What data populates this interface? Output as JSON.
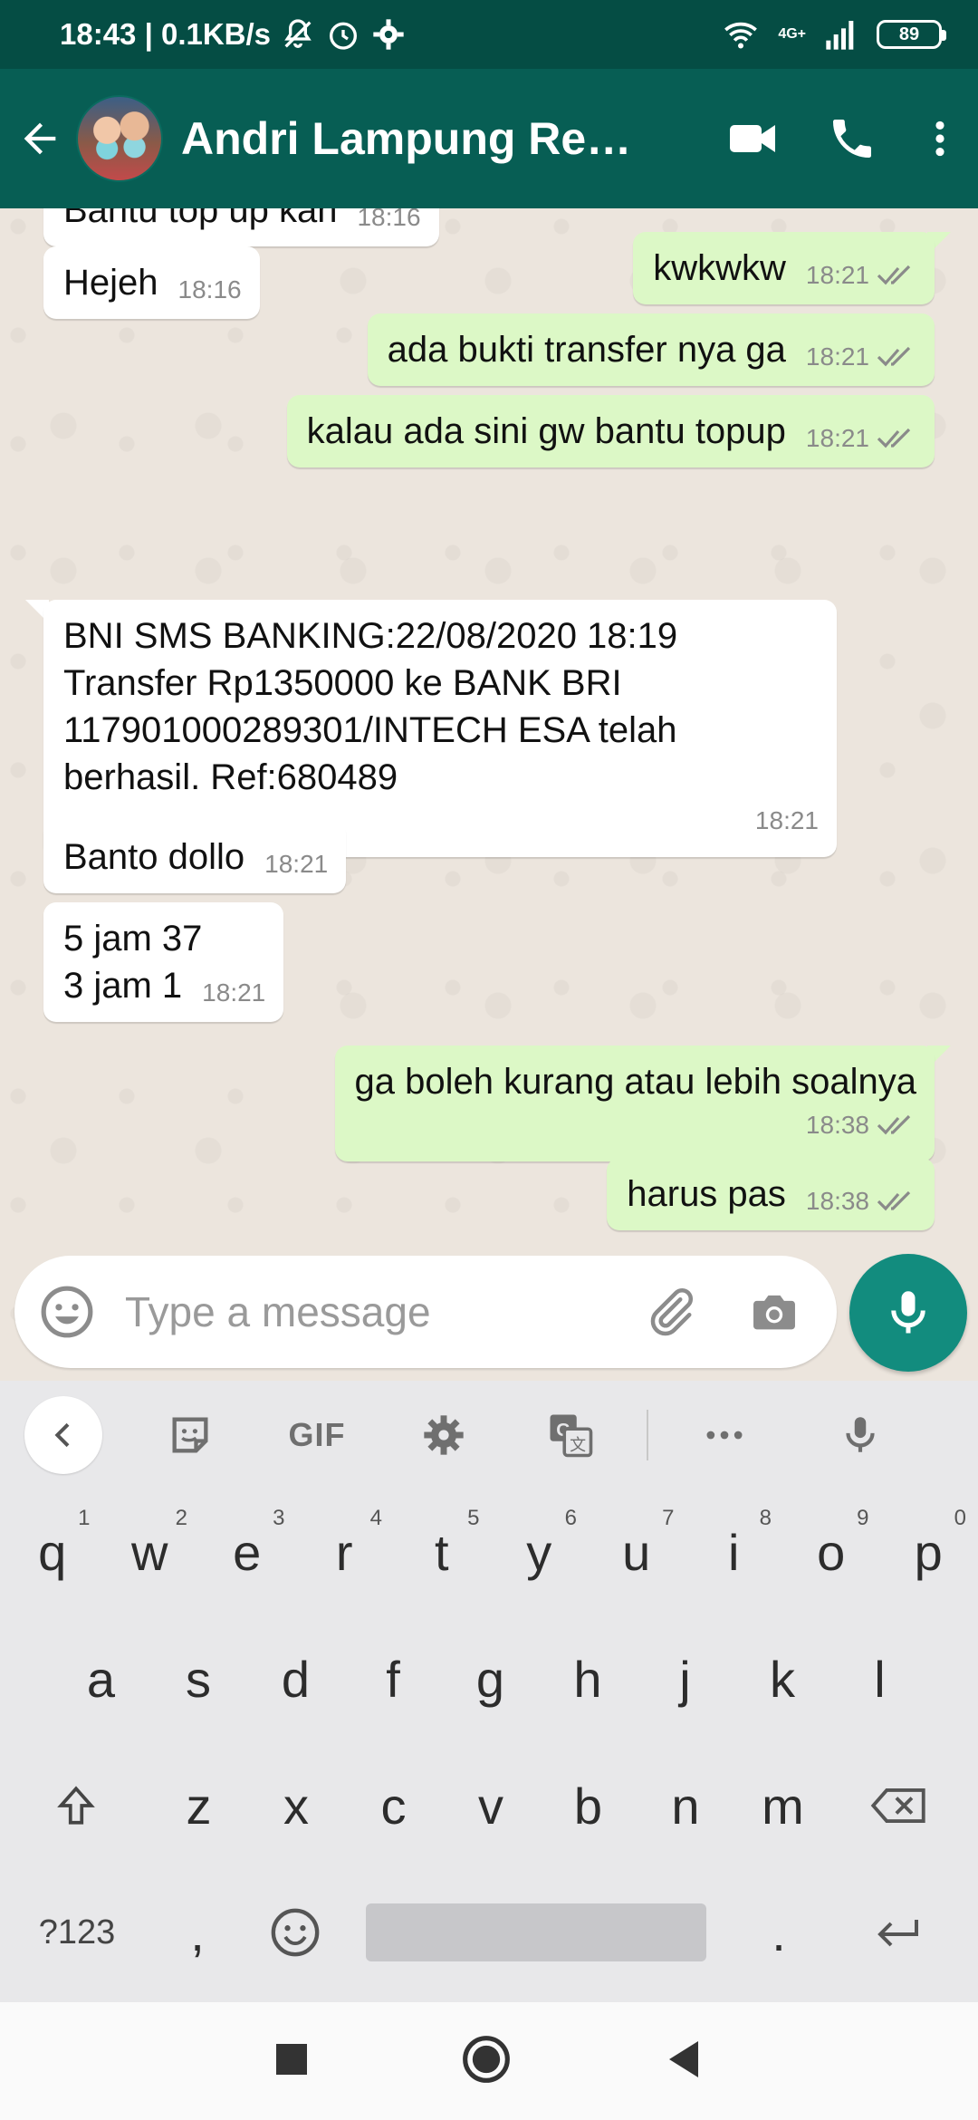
{
  "status_bar": {
    "time_speed": "18:43 | 0.1KB/s",
    "network": "4G+",
    "battery": "89"
  },
  "app_bar": {
    "contact_name": "Andri Lampung Rese..."
  },
  "messages": [
    {
      "dir": "in",
      "text": "Bantu top up kan",
      "time": "18:16"
    },
    {
      "dir": "in",
      "text": "Hejeh",
      "time": "18:16"
    },
    {
      "dir": "out",
      "text": "kwkwkw",
      "time": "18:21"
    },
    {
      "dir": "out",
      "text": "ada bukti transfer nya ga",
      "time": "18:21"
    },
    {
      "dir": "out",
      "text": "kalau ada sini gw bantu topup",
      "time": "18:21"
    },
    {
      "dir": "in",
      "text": "BNI SMS BANKING:22/08/2020 18:19\nTransfer Rp1350000 ke BANK BRI\n117901000289301/INTECH ESA telah\nberhasil. Ref:680489",
      "time": "18:21"
    },
    {
      "dir": "in",
      "text": "Banto dollo",
      "time": "18:21"
    },
    {
      "dir": "in",
      "text": "5 jam 37\n3 jam 1",
      "time": "18:21"
    },
    {
      "dir": "out",
      "text": "ga boleh kurang atau lebih soalnya",
      "time": "18:38"
    },
    {
      "dir": "out",
      "text": "harus pas",
      "time": "18:38"
    }
  ],
  "composer": {
    "placeholder": "Type a message"
  },
  "keyboard": {
    "toolbar_gif": "GIF",
    "row1": [
      {
        "k": "q",
        "n": "1"
      },
      {
        "k": "w",
        "n": "2"
      },
      {
        "k": "e",
        "n": "3"
      },
      {
        "k": "r",
        "n": "4"
      },
      {
        "k": "t",
        "n": "5"
      },
      {
        "k": "y",
        "n": "6"
      },
      {
        "k": "u",
        "n": "7"
      },
      {
        "k": "i",
        "n": "8"
      },
      {
        "k": "o",
        "n": "9"
      },
      {
        "k": "p",
        "n": "0"
      }
    ],
    "row2": [
      "a",
      "s",
      "d",
      "f",
      "g",
      "h",
      "j",
      "k",
      "l"
    ],
    "row3": [
      "z",
      "x",
      "c",
      "v",
      "b",
      "n",
      "m"
    ],
    "symbols_key": "?123",
    "comma_key": ",",
    "period_key": "."
  },
  "icons": {
    "accent": "#075e54",
    "outgoing_bubble": "#dcf8c6",
    "fab": "#128c7e",
    "read_ticks": "#34b7f1"
  }
}
